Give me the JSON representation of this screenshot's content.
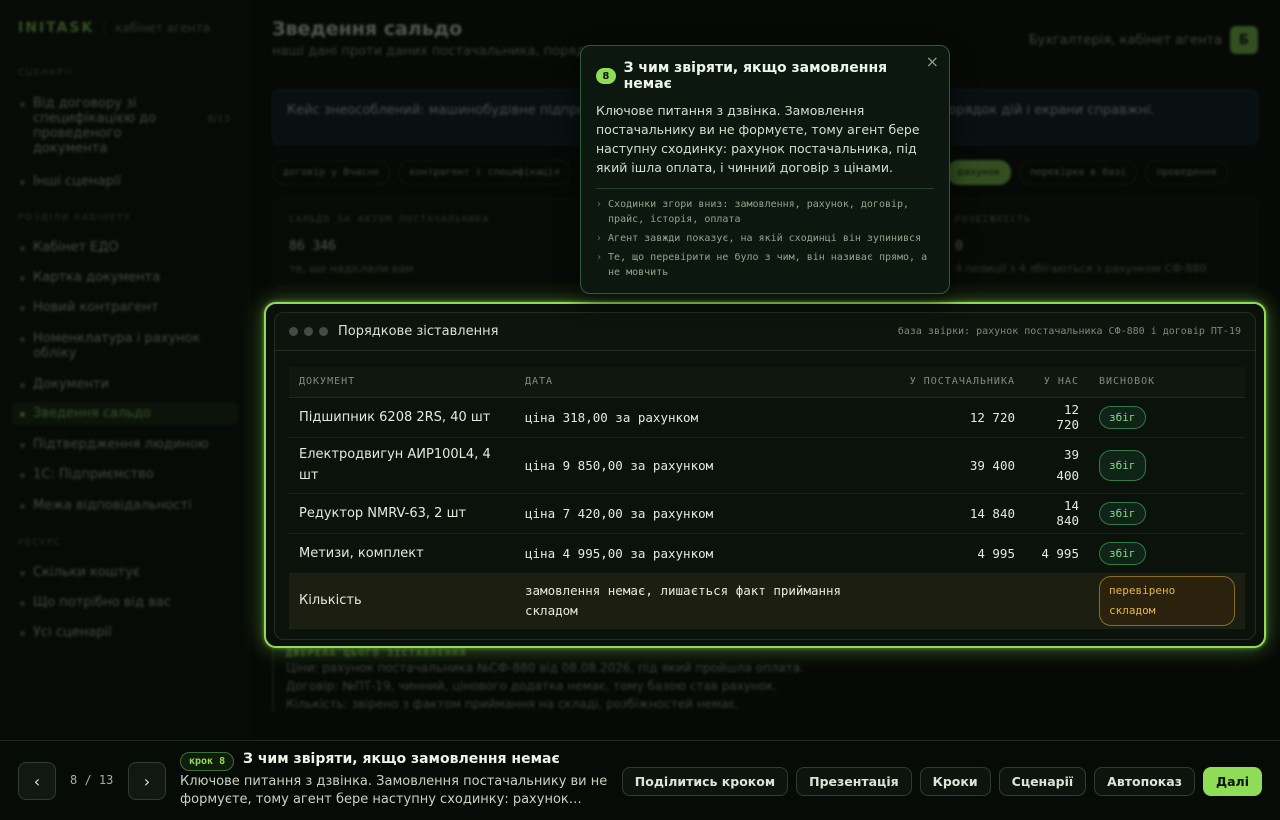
{
  "brand": {
    "logo": "INITASK",
    "subtitle": "кабінет агента"
  },
  "sidebar": {
    "sections": [
      {
        "label": "СЦЕНАРІЇ"
      },
      {
        "label": "РОЗДІЛИ КАБІНЕТУ"
      },
      {
        "label": "РЕСУРС"
      }
    ],
    "scenario_items": [
      {
        "label": "Від договору зі специфікацією до проведеного документа",
        "count": "8/13"
      },
      {
        "label": "Інші сценарії"
      }
    ],
    "cabinet_items": [
      {
        "label": "Кабінет ЕДО"
      },
      {
        "label": "Картка документа"
      },
      {
        "label": "Новий контрагент"
      },
      {
        "label": "Номенклатура і рахунок обліку"
      },
      {
        "label": "Документи"
      },
      {
        "label": "Зведення сальдо"
      },
      {
        "label": "Підтвердження людиною"
      },
      {
        "label": "1С: Підприємство"
      },
      {
        "label": "Межа відповідальності"
      }
    ],
    "resource_items": [
      {
        "label": "Скільки коштує"
      },
      {
        "label": "Що потрібно від вас"
      },
      {
        "label": "Усі сценарії"
      }
    ]
  },
  "header": {
    "title": "Зведення сальдо",
    "subtitle": "наші дані проти даних постачальника, порядк",
    "account": "Бухгалтерія, кабінет агента",
    "avatar": "Б"
  },
  "case_text": "Кейс знеособлений: машинобудівне підприємство … імена, номери документів і суми змінені, порядок дій і екрани справжні.",
  "chips": [
    {
      "label": "договір у Вчасно",
      "active": false
    },
    {
      "label": "контрагент і специфікація",
      "active": false
    },
    {
      "label": "рахунок",
      "active": true
    },
    {
      "label": "перевірка в базі",
      "active": false
    },
    {
      "label": "проведення",
      "active": false
    }
  ],
  "kpis": [
    {
      "label": "САЛЬДО ЗА АКТОМ ПОСТАЧАЛЬНИКА",
      "value": "86 346",
      "note": "те, що надіслали вам"
    },
    {
      "label": "РОЗБІЖНІСТЬ",
      "value": "0",
      "note": "4 позиції з 4 збігаються з рахунком СФ-880"
    }
  ],
  "panel": {
    "title": "Порядкове зіставлення",
    "base": "база звірки: рахунок постачальника СФ-880 і договір ПТ-19",
    "columns": [
      "ДОКУМЕНТ",
      "ДАТА",
      "У ПОСТАЧАЛЬНИКА",
      "У НАС",
      "ВИСНОВОК"
    ],
    "rows": [
      {
        "doc": "Підшипник 6208 2RS, 40 шт",
        "date": "ціна 318,00 за рахунком",
        "supplier": "12 720",
        "ours": "12 720",
        "verdict": "збіг",
        "status": "ok"
      },
      {
        "doc": "Електродвигун АИР100L4, 4 шт",
        "date": "ціна 9 850,00 за рахунком",
        "supplier": "39 400",
        "ours": "39 400",
        "verdict": "збіг",
        "status": "ok"
      },
      {
        "doc": "Редуктор NMRV-63, 2 шт",
        "date": "ціна 7 420,00 за рахунком",
        "supplier": "14 840",
        "ours": "14 840",
        "verdict": "збіг",
        "status": "ok"
      },
      {
        "doc": "Метизи, комплект",
        "date": "ціна 4 995,00 за рахунком",
        "supplier": "4 995",
        "ours": "4 995",
        "verdict": "збіг",
        "status": "ok"
      },
      {
        "doc": "Кількість",
        "date": "замовлення немає, лишається факт приймання складом",
        "supplier": "",
        "ours": "",
        "verdict": "перевірено складом",
        "status": "warn"
      }
    ]
  },
  "sources": {
    "heading": "ДЖЕРЕЛА ЦЬОГО ЗІСТАВЛЕННЯ",
    "lines": [
      "Ціни: рахунок постачальника №СФ-880 від 08.08.2026, під який пройшла оплата.",
      "Договір: №ПТ-19, чинний, цінового додатка немає, тому базою став рахунок.",
      "Кількість: звірено з фактом приймання на складі, розбіжностей немає."
    ]
  },
  "tooltip": {
    "num": "8",
    "title": "З чим звіряти, якщо замовлення немає",
    "body": "Ключове питання з дзвінка. Замовлення постачальнику ви не формуєте, тому агент бере наступну сходинку: рахунок постачальника, під який ішла оплата, і чинний договір з цінами.",
    "bullets": [
      "Сходинки згори вниз: замовлення, рахунок, договір, прайс, історія, оплата",
      "Агент завжди показує, на якій сходинці він зупинився",
      "Те, що перевірити не було з чим, він називає прямо, а не мовчить"
    ],
    "close": "×"
  },
  "bottom": {
    "prev": "‹",
    "next": "›",
    "counter": "8 / 13",
    "step_badge": "крок 8",
    "step_title": "З чим звіряти, якщо замовлення немає",
    "step_desc": "Ключове питання з дзвінка. Замовлення постачальнику ви не формуєте, тому агент бере наступну сходинку: рахунок…",
    "actions": [
      "Поділитись кроком",
      "Презентація",
      "Кроки",
      "Сценарії",
      "Автопоказ",
      "Далі"
    ]
  }
}
